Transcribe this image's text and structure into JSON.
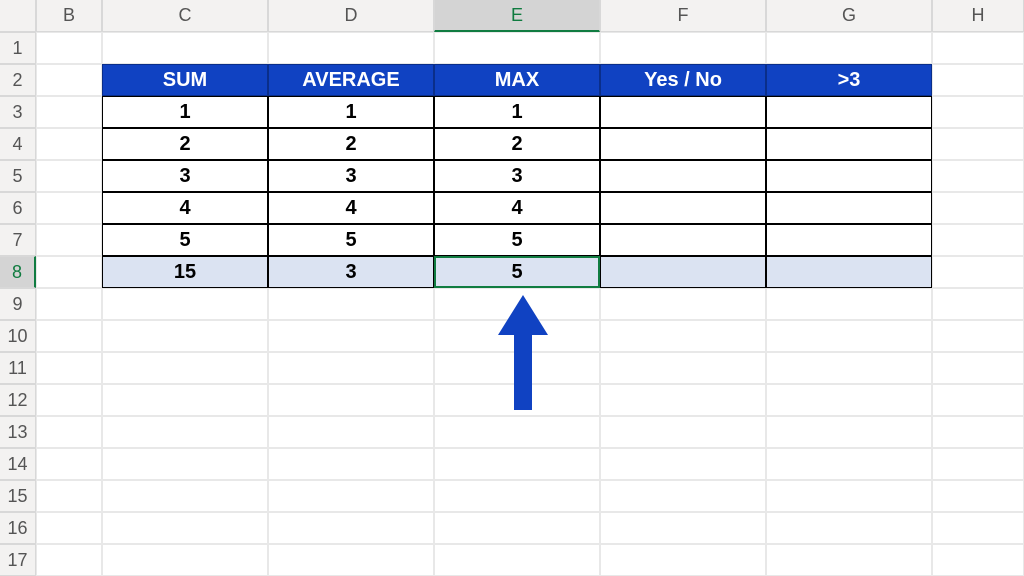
{
  "columns": [
    "B",
    "C",
    "D",
    "E",
    "F",
    "G",
    "H"
  ],
  "rows": [
    "1",
    "2",
    "3",
    "4",
    "5",
    "6",
    "7",
    "8",
    "9",
    "10",
    "11",
    "12",
    "13",
    "14",
    "15",
    "16",
    "17"
  ],
  "selected_col_index": 3,
  "selected_row_index": 7,
  "headers": {
    "C": "SUM",
    "D": "AVERAGE",
    "E": "MAX",
    "F": "Yes / No",
    "G": ">3"
  },
  "table": {
    "rows": [
      {
        "C": "1",
        "D": "1",
        "E": "1",
        "F": "",
        "G": ""
      },
      {
        "C": "2",
        "D": "2",
        "E": "2",
        "F": "",
        "G": ""
      },
      {
        "C": "3",
        "D": "3",
        "E": "3",
        "F": "",
        "G": ""
      },
      {
        "C": "4",
        "D": "4",
        "E": "4",
        "F": "",
        "G": ""
      },
      {
        "C": "5",
        "D": "5",
        "E": "5",
        "F": "",
        "G": ""
      }
    ],
    "summary": {
      "C": "15",
      "D": "3",
      "E": "5",
      "F": "",
      "G": ""
    }
  },
  "chart_data": {
    "type": "table",
    "title": "",
    "columns": [
      "SUM",
      "AVERAGE",
      "MAX",
      "Yes / No",
      ">3"
    ],
    "data": [
      [
        1,
        1,
        1,
        null,
        null
      ],
      [
        2,
        2,
        2,
        null,
        null
      ],
      [
        3,
        3,
        3,
        null,
        null
      ],
      [
        4,
        4,
        4,
        null,
        null
      ],
      [
        5,
        5,
        5,
        null,
        null
      ],
      [
        15,
        3,
        5,
        null,
        null
      ]
    ]
  },
  "arrow_color": "#1042c2"
}
